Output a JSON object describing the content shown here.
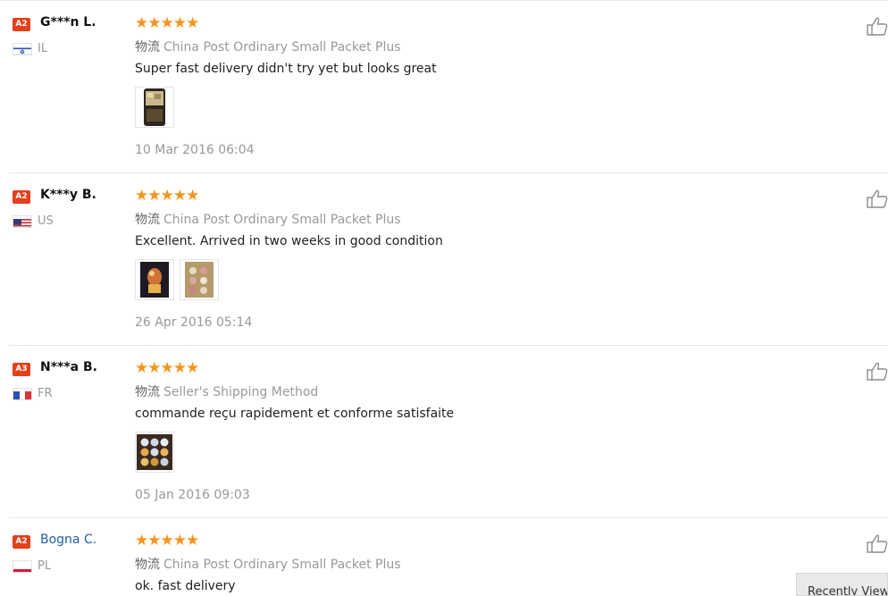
{
  "reviews": [
    {
      "level": "A2",
      "name": "G***n L.",
      "country": "IL",
      "rating": 5,
      "stars": "★★★★★",
      "shipping_cn": "物流",
      "shipping": "China Post Ordinary Small Packet Plus",
      "comment": "Super fast delivery didn't try yet but looks great",
      "date": "10 Mar 2016 06:04"
    },
    {
      "level": "A2",
      "name": "K***y B.",
      "country": "US",
      "rating": 5,
      "stars": "★★★★★",
      "shipping_cn": "物流",
      "shipping": "China Post Ordinary Small Packet Plus",
      "comment": "Excellent. Arrived in two weeks in good condition",
      "date": "26 Apr 2016 05:14"
    },
    {
      "level": "A3",
      "name": "N***a B.",
      "country": "FR",
      "rating": 5,
      "stars": "★★★★★",
      "shipping_cn": "物流",
      "shipping": "Seller's Shipping Method",
      "comment": "commande reçu rapidement et conforme satisfaite",
      "date": "05 Jan 2016 09:03"
    },
    {
      "level": "A2",
      "name": "Bogna C.",
      "country": "PL",
      "rating": 5,
      "stars": "★★★★★",
      "shipping_cn": "物流",
      "shipping": "China Post Ordinary Small Packet Plus",
      "comment": "ok. fast delivery"
    }
  ],
  "recently_viewed": "Recently Viewed",
  "colors": {
    "star": "#f7941d",
    "badge": "#e3401b",
    "link": "#1f5fa8",
    "muted": "#999999"
  },
  "icons": {
    "like": "thumbs-up-icon"
  }
}
